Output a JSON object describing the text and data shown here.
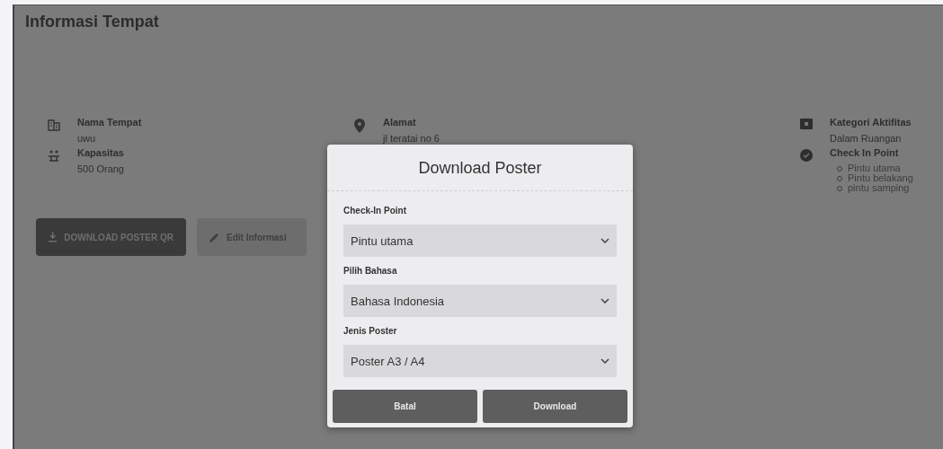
{
  "page": {
    "title": "Informasi Tempat"
  },
  "info_columns": [
    {
      "items": [
        {
          "kind": "text",
          "label": "Nama Tempat",
          "value": "uwu"
        },
        {
          "kind": "text",
          "label": "Kapasitas",
          "value": "500 Orang"
        }
      ]
    },
    {
      "items": [
        {
          "kind": "text",
          "label": "Alamat",
          "value": "jl teratai no 6"
        }
      ]
    },
    {
      "items": [
        {
          "kind": "text",
          "label": "Kategori Aktifitas",
          "value": "Dalam Ruangan"
        },
        {
          "kind": "list",
          "label": "Check In Point",
          "values": [
            "Pintu utama",
            "Pintu belakang",
            "pintu samping"
          ]
        }
      ]
    }
  ],
  "actions": [
    {
      "kind": "primary",
      "label": "DOWNLOAD POSTER QR"
    },
    {
      "kind": "secondary",
      "label": "Edit Informasi"
    }
  ],
  "dialog": {
    "title": "Download Poster",
    "fields": [
      {
        "label": "Check-In Point",
        "value": "Pintu utama"
      },
      {
        "label": "Pilih Bahasa",
        "value": "Bahasa Indonesia"
      },
      {
        "label": "Jenis Poster",
        "value": "Poster A3 / A4"
      }
    ],
    "buttons": [
      "Batal",
      "Download"
    ]
  }
}
